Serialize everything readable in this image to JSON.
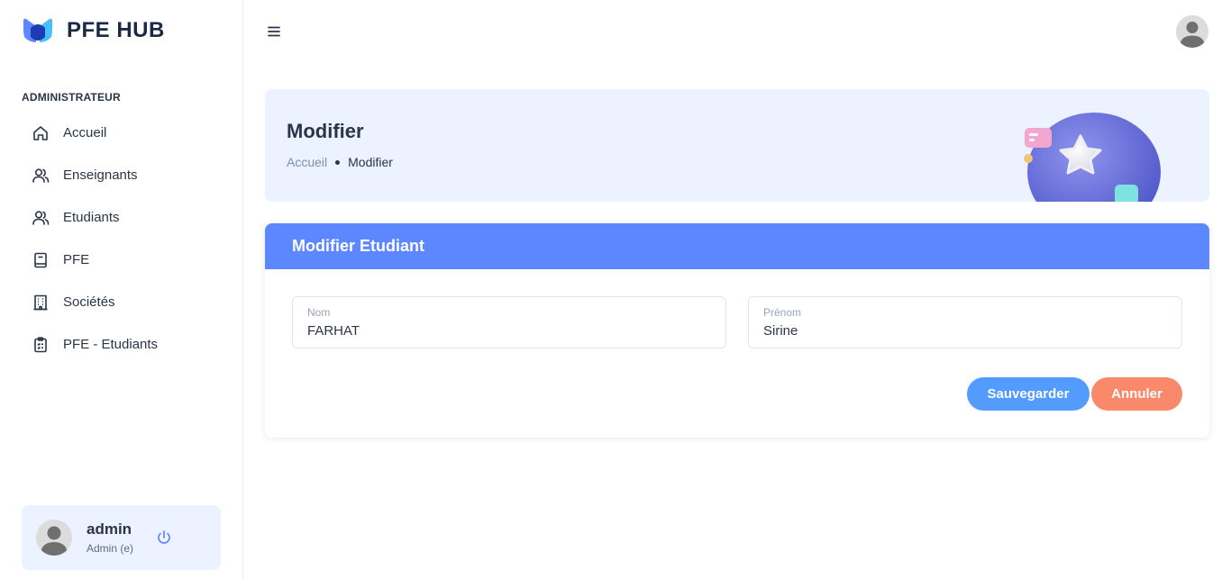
{
  "app": {
    "name": "PFE HUB"
  },
  "sidebar": {
    "section_label": "ADMINISTRATEUR",
    "items": [
      {
        "label": "Accueil",
        "icon": "home-icon"
      },
      {
        "label": "Enseignants",
        "icon": "users-icon"
      },
      {
        "label": "Etudiants",
        "icon": "users-icon"
      },
      {
        "label": "PFE",
        "icon": "book-icon"
      },
      {
        "label": "Sociétés",
        "icon": "building-icon"
      },
      {
        "label": "PFE - Etudiants",
        "icon": "clipboard-icon"
      }
    ],
    "profile": {
      "name": "admin",
      "role": "Admin (e)"
    }
  },
  "banner": {
    "title": "Modifier",
    "breadcrumb": {
      "parent": "Accueil",
      "current": "Modifier"
    }
  },
  "form": {
    "title": "Modifier Etudiant",
    "nom": {
      "label": "Nom",
      "value": "FARHAT"
    },
    "prenom": {
      "label": "Prénom",
      "value": "Sirine"
    },
    "save_label": "Sauvegarder",
    "cancel_label": "Annuler"
  },
  "colors": {
    "primary": "#5d87ff",
    "save_button": "#539bff",
    "cancel_button": "#fa896b",
    "banner_bg": "#ecf2ff"
  }
}
